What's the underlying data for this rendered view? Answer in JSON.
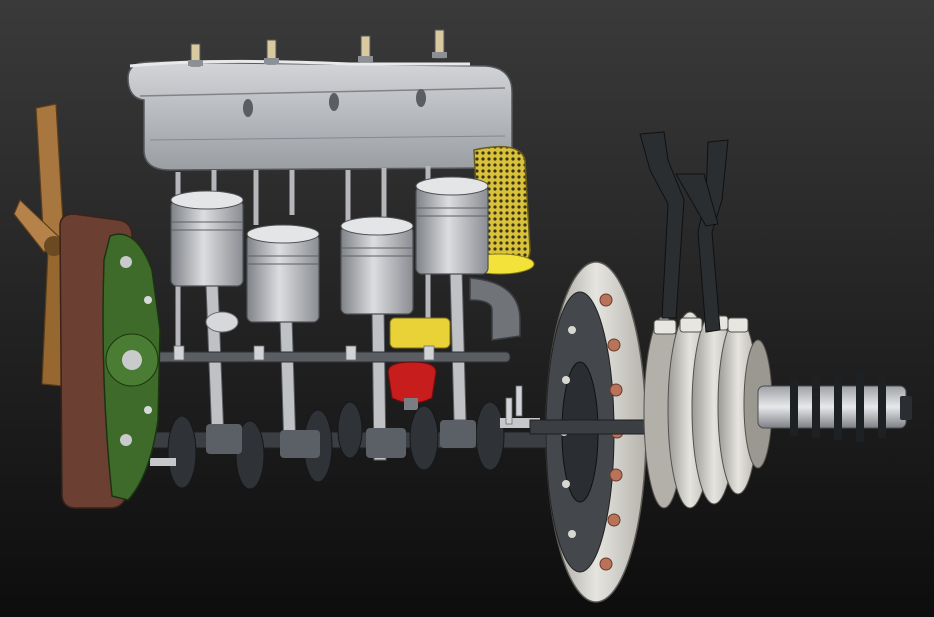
{
  "viewport": {
    "background_top": "#3a3a3a",
    "background_bottom": "#0d0d0d"
  },
  "colors": {
    "metal": "#c9cacc",
    "metal_dark": "#8d8f93",
    "head_cover": "#b9bcc0",
    "fan_blade": "#a8773f",
    "belt": "#6b3f31",
    "flywheel_plate": "#3e6b2a",
    "air_filter": "#d9c23a",
    "filter_base": "#f2e23a",
    "oil_filter": "#c81d1d",
    "pipe": "#707479",
    "crank": "#3b3f44",
    "clutch_disc": "#d8d6d1",
    "copper": "#b8735a",
    "lever": "#2b2e31"
  },
  "parts": {
    "cylinders": 4,
    "spark_plugs": 4,
    "clutch_plates": 5,
    "fan_blades": 3
  }
}
